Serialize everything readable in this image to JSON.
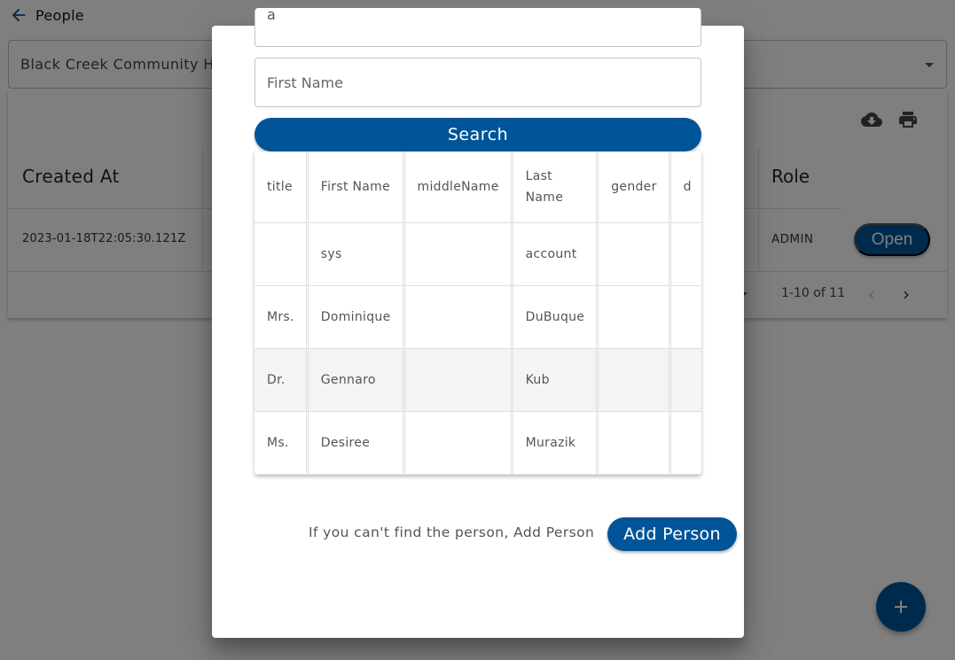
{
  "page": {
    "title": "People",
    "back_icon": "arrow-left-icon",
    "organization_select": {
      "value": "Black Creek Community H",
      "icon": "caret-down-icon"
    },
    "toolbar": {
      "download_icon": "cloud-download-icon",
      "print_icon": "print-icon"
    },
    "table": {
      "headers": [
        "Created At",
        "Role"
      ],
      "rows": [
        {
          "created_at": "2023-01-18T22:05:30.121Z",
          "role": "ADMIN",
          "action_label": "Open"
        }
      ],
      "pagination": {
        "range_text": "1-10 of 11",
        "prev_icon": "chevron-left-icon",
        "next_icon": "chevron-right-icon"
      }
    },
    "fab": {
      "icon": "plus-icon"
    },
    "colors": {
      "primary": "#005599",
      "overlay": "rgba(0,0,0,0.5)"
    }
  },
  "modal": {
    "top_field": {
      "value": "a"
    },
    "first_name_field": {
      "placeholder": "First Name",
      "value": ""
    },
    "search_label": "Search",
    "results": {
      "headers": [
        "title",
        "First Name",
        "middleName",
        "Last Name",
        "gender",
        "d"
      ],
      "rows": [
        {
          "title": "",
          "first_name": "sys",
          "middle_name": "",
          "last_name": "account",
          "gender": "",
          "extra": ""
        },
        {
          "title": "Mrs.",
          "first_name": "Dominique",
          "middle_name": "",
          "last_name": "DuBuque",
          "gender": "",
          "extra": ""
        },
        {
          "title": "Dr.",
          "first_name": "Gennaro",
          "middle_name": "",
          "last_name": "Kub",
          "gender": "",
          "extra": ""
        },
        {
          "title": "Ms.",
          "first_name": "Desiree",
          "middle_name": "",
          "last_name": "Murazik",
          "gender": "",
          "extra": ""
        }
      ]
    },
    "not_found_text": "If you can't find the person, Add Person",
    "add_person_label": "Add Person"
  }
}
